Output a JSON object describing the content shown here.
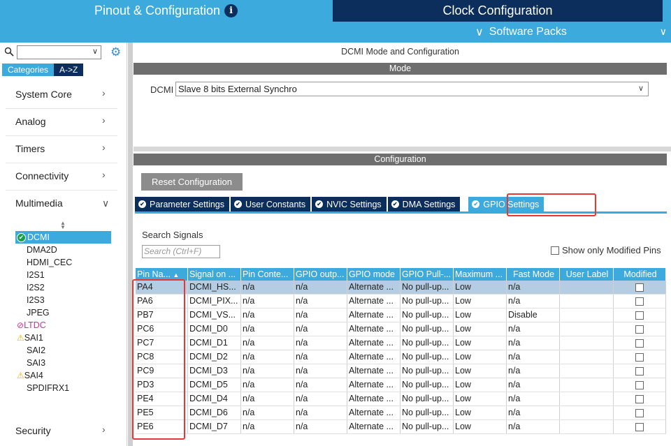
{
  "header": {
    "tab_pinout": "Pinout & Configuration",
    "info_glyph": "i",
    "tab_clock": "Clock Configuration",
    "software_packs": "Software Packs"
  },
  "sidebar": {
    "search_placeholder": "",
    "tab_categories": "Categories",
    "tab_az": "A->Z",
    "categories": [
      "System Core",
      "Analog",
      "Timers",
      "Connectivity",
      "Multimedia",
      "Security"
    ],
    "peripherals": [
      {
        "label": "DCMI",
        "status": "ok",
        "selected": true
      },
      {
        "label": "DMA2D",
        "status": "none"
      },
      {
        "label": "HDMI_CEC",
        "status": "none"
      },
      {
        "label": "I2S1",
        "status": "none"
      },
      {
        "label": "I2S2",
        "status": "none"
      },
      {
        "label": "I2S3",
        "status": "none"
      },
      {
        "label": "JPEG",
        "status": "none"
      },
      {
        "label": "LTDC",
        "status": "unavailable"
      },
      {
        "label": "SAI1",
        "status": "warning"
      },
      {
        "label": "SAI2",
        "status": "none"
      },
      {
        "label": "SAI3",
        "status": "none"
      },
      {
        "label": "SAI4",
        "status": "warning"
      },
      {
        "label": "SPDIFRX1",
        "status": "none"
      }
    ]
  },
  "main": {
    "panel_title": "DCMI Mode and Configuration",
    "mode_bar": "Mode",
    "mode_label": "DCMI",
    "mode_value": "Slave 8 bits External Synchro",
    "config_bar": "Configuration",
    "reset_button": "Reset Configuration",
    "tabs": [
      "Parameter Settings",
      "User Constants",
      "NVIC Settings",
      "DMA Settings",
      "GPIO Settings"
    ],
    "active_tab": "GPIO Settings",
    "search_signals_label": "Search Signals",
    "search_signals_placeholder": "Search (Ctrl+F)",
    "show_only_modified": "Show only Modified Pins"
  },
  "table": {
    "columns": [
      "Pin Na...",
      "Signal on ...",
      "Pin Conte...",
      "GPIO outp...",
      "GPIO mode",
      "GPIO Pull-...",
      "Maximum ...",
      "Fast Mode",
      "User Label",
      "Modified"
    ],
    "rows": [
      [
        "PA4",
        "DCMI_HS...",
        "n/a",
        "n/a",
        "Alternate ...",
        "No pull-up...",
        "Low",
        "n/a",
        "",
        ""
      ],
      [
        "PA6",
        "DCMI_PIX...",
        "n/a",
        "n/a",
        "Alternate ...",
        "No pull-up...",
        "Low",
        "n/a",
        "",
        ""
      ],
      [
        "PB7",
        "DCMI_VS...",
        "n/a",
        "n/a",
        "Alternate ...",
        "No pull-up...",
        "Low",
        "Disable",
        "",
        ""
      ],
      [
        "PC6",
        "DCMI_D0",
        "n/a",
        "n/a",
        "Alternate ...",
        "No pull-up...",
        "Low",
        "n/a",
        "",
        ""
      ],
      [
        "PC7",
        "DCMI_D1",
        "n/a",
        "n/a",
        "Alternate ...",
        "No pull-up...",
        "Low",
        "n/a",
        "",
        ""
      ],
      [
        "PC8",
        "DCMI_D2",
        "n/a",
        "n/a",
        "Alternate ...",
        "No pull-up...",
        "Low",
        "n/a",
        "",
        ""
      ],
      [
        "PC9",
        "DCMI_D3",
        "n/a",
        "n/a",
        "Alternate ...",
        "No pull-up...",
        "Low",
        "n/a",
        "",
        ""
      ],
      [
        "PD3",
        "DCMI_D5",
        "n/a",
        "n/a",
        "Alternate ...",
        "No pull-up...",
        "Low",
        "n/a",
        "",
        ""
      ],
      [
        "PE4",
        "DCMI_D4",
        "n/a",
        "n/a",
        "Alternate ...",
        "No pull-up...",
        "Low",
        "n/a",
        "",
        ""
      ],
      [
        "PE5",
        "DCMI_D6",
        "n/a",
        "n/a",
        "Alternate ...",
        "No pull-up...",
        "Low",
        "n/a",
        "",
        ""
      ],
      [
        "PE6",
        "DCMI_D7",
        "n/a",
        "n/a",
        "Alternate ...",
        "No pull-up...",
        "Low",
        "n/a",
        "",
        ""
      ]
    ]
  },
  "colors": {
    "accent": "#3caadc",
    "dark_navy": "#0b2e5c",
    "highlight_red": "#e53935",
    "ok_green": "#1aa04a",
    "warning_yellow": "#f0b000",
    "unavailable_magenta": "#d32f90"
  }
}
